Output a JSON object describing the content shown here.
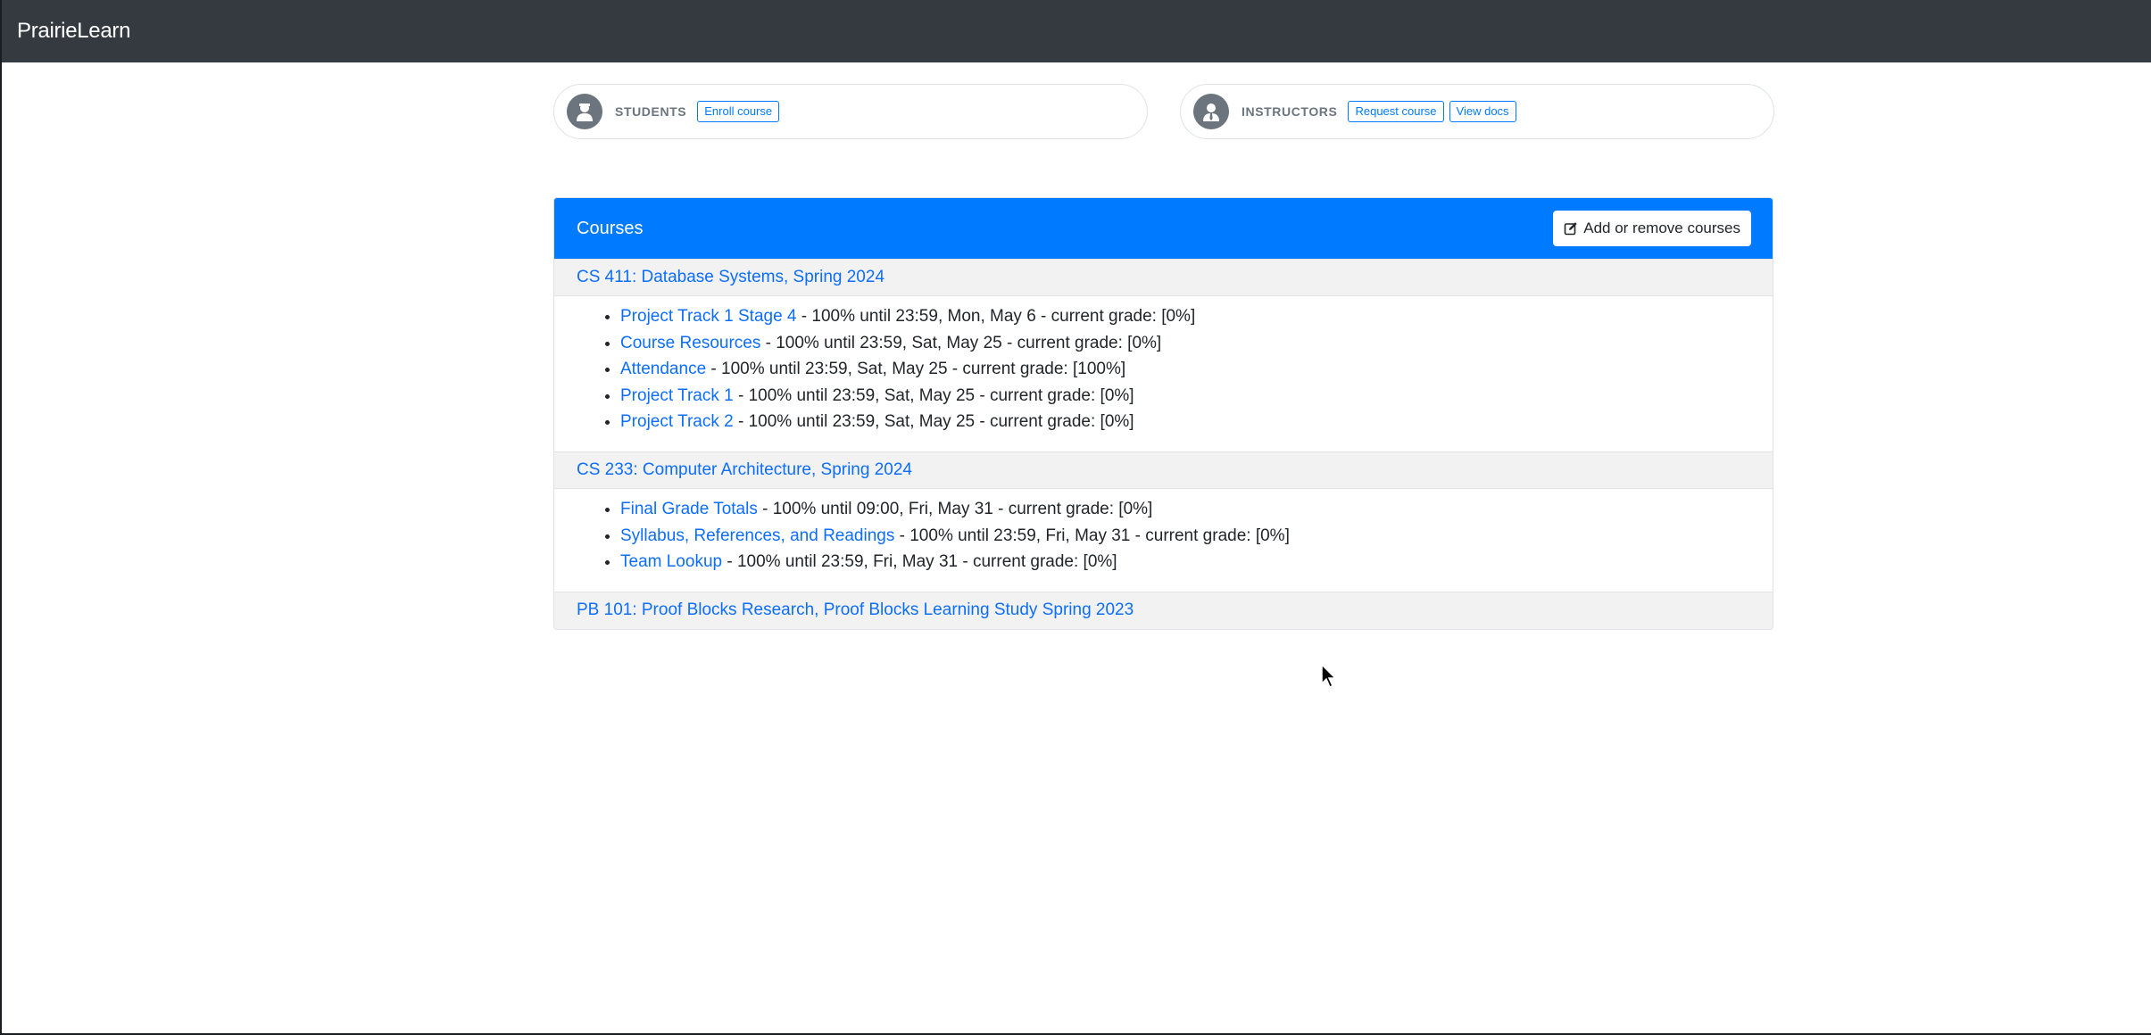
{
  "navbar": {
    "brand": "PrairieLearn"
  },
  "students": {
    "label": "STUDENTS",
    "enroll_button": "Enroll course"
  },
  "instructors": {
    "label": "INSTRUCTORS",
    "request_button": "Request course",
    "docs_button": "View docs"
  },
  "courses": {
    "title": "Courses",
    "add_remove_button": "Add or remove courses",
    "list": [
      {
        "name": "CS 411: Database Systems, Spring 2024",
        "assessments": [
          {
            "title": "Project Track 1 Stage 4",
            "detail": " - 100% until 23:59, Mon, May 6 - current grade: [0%]"
          },
          {
            "title": "Course Resources",
            "detail": " - 100% until 23:59, Sat, May 25 - current grade: [0%]"
          },
          {
            "title": "Attendance",
            "detail": " - 100% until 23:59, Sat, May 25 - current grade: [100%]"
          },
          {
            "title": "Project Track 1",
            "detail": " - 100% until 23:59, Sat, May 25 - current grade: [0%]"
          },
          {
            "title": "Project Track 2",
            "detail": " - 100% until 23:59, Sat, May 25 - current grade: [0%]"
          }
        ]
      },
      {
        "name": "CS 233: Computer Architecture, Spring 2024",
        "assessments": [
          {
            "title": "Final Grade Totals",
            "detail": " - 100% until 09:00, Fri, May 31 - current grade: [0%]"
          },
          {
            "title": "Syllabus, References, and Readings",
            "detail": " - 100% until 23:59, Fri, May 31 - current grade: [0%]"
          },
          {
            "title": "Team Lookup",
            "detail": " - 100% until 23:59, Fri, May 31 - current grade: [0%]"
          }
        ]
      },
      {
        "name": "PB 101: Proof Blocks Research, Proof Blocks Learning Study Spring 2023",
        "assessments": []
      }
    ]
  },
  "icons": {
    "student": "user-graduate-icon",
    "instructor": "user-tie-icon",
    "edit": "edit-icon",
    "cursor": "mouse-pointer-icon"
  },
  "colors": {
    "navbar": "#343a40",
    "primary": "#007bff",
    "link": "#0d6efd",
    "row_bg": "#f2f2f2"
  }
}
